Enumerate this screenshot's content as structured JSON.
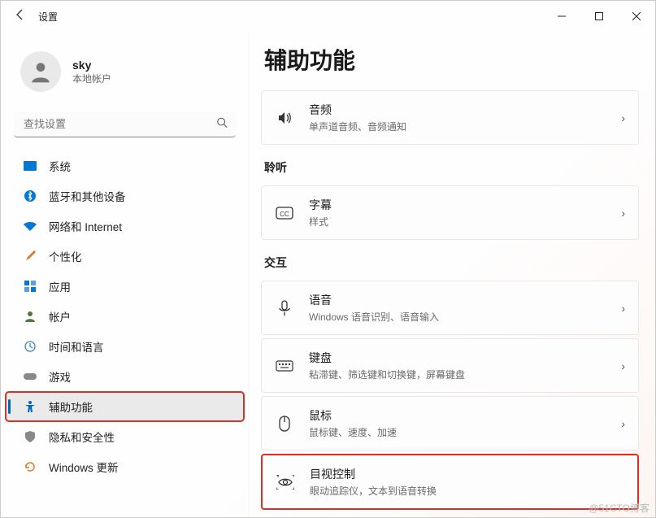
{
  "window": {
    "title": "设置"
  },
  "profile": {
    "name": "sky",
    "subtitle": "本地帐户"
  },
  "search": {
    "placeholder": "查找设置"
  },
  "sidebar": {
    "items": [
      {
        "label": "系统"
      },
      {
        "label": "蓝牙和其他设备"
      },
      {
        "label": "网络和 Internet"
      },
      {
        "label": "个性化"
      },
      {
        "label": "应用"
      },
      {
        "label": "帐户"
      },
      {
        "label": "时间和语言"
      },
      {
        "label": "游戏"
      },
      {
        "label": "辅助功能"
      },
      {
        "label": "隐私和安全性"
      },
      {
        "label": "Windows 更新"
      }
    ]
  },
  "main": {
    "heading": "辅助功能",
    "sections": {
      "audio": {
        "title": "音频",
        "sub": "单声道音频、音频通知"
      },
      "hearing_label": "聆听",
      "captions": {
        "title": "字幕",
        "sub": "样式"
      },
      "interaction_label": "交互",
      "speech": {
        "title": "语音",
        "sub": "Windows 语音识别、语音输入"
      },
      "keyboard": {
        "title": "键盘",
        "sub": "粘滞键、筛选键和切换键，屏幕键盘"
      },
      "mouse": {
        "title": "鼠标",
        "sub": "鼠标键、速度、加速"
      },
      "eyecontrol": {
        "title": "目视控制",
        "sub": "眼动追踪仪，文本到语音转换"
      }
    }
  },
  "watermark": "@51CTO博客"
}
